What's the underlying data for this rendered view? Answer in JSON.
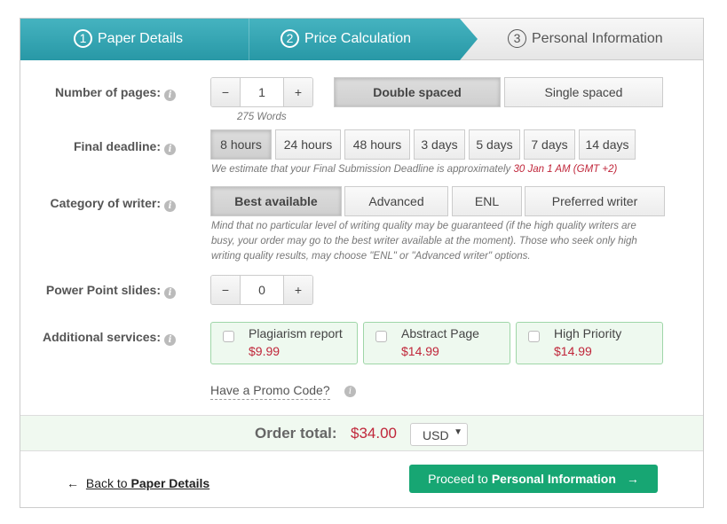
{
  "steps": [
    {
      "num": "1",
      "label": "Paper Details"
    },
    {
      "num": "2",
      "label": "Price Calculation"
    },
    {
      "num": "3",
      "label": "Personal Information"
    }
  ],
  "pages": {
    "label": "Number of pages:",
    "value": "1",
    "minus": "−",
    "plus": "+",
    "words": "275 Words",
    "spacing": [
      "Double spaced",
      "Single spaced"
    ],
    "selected_spacing": "Double spaced"
  },
  "deadline": {
    "label": "Final deadline:",
    "options": [
      "8 hours",
      "24 hours",
      "48 hours",
      "3 days",
      "5 days",
      "7 days",
      "14 days"
    ],
    "selected": "8 hours",
    "note": "We estimate that your Final Submission Deadline is approximately ",
    "date": "30 Jan 1 AM (GMT +2)"
  },
  "writer": {
    "label": "Category of writer:",
    "options": [
      "Best available",
      "Advanced",
      "ENL",
      "Preferred writer"
    ],
    "selected": "Best available",
    "note": "Mind that no particular level of writing quality may be guaranteed (if the high quality writers are busy, your order may go to the best writer available at the moment). Those who seek only high writing quality results, may choose \"ENL\" or \"Advanced writer\" options."
  },
  "slides": {
    "label": "Power Point slides:",
    "value": "0",
    "minus": "−",
    "plus": "+"
  },
  "services": {
    "label": "Additional services:",
    "items": [
      {
        "name": "Plagiarism report",
        "price": "$9.99",
        "checked": false
      },
      {
        "name": "Abstract Page",
        "price": "$14.99",
        "checked": false
      },
      {
        "name": "High Priority",
        "price": "$14.99",
        "checked": false
      }
    ]
  },
  "promo": "Have a Promo Code?",
  "total": {
    "label": "Order total:",
    "value": "$34.00",
    "currency": "USD"
  },
  "footer": {
    "back_prefix": "Back to ",
    "back_strong": "Paper Details",
    "proceed_prefix": "Proceed to ",
    "proceed_strong": "Personal Information",
    "arrow_left": "←",
    "arrow_right": "→"
  },
  "colors": {
    "teal": "#2fa3b1",
    "green_button": "#17a673",
    "price_red": "#c0263a"
  }
}
